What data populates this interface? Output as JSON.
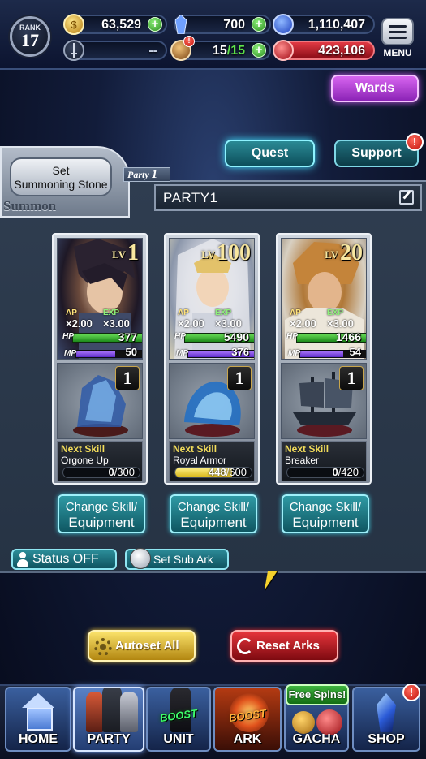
{
  "hud": {
    "rank_label": "RANK",
    "rank_value": "17",
    "gold": "63,529",
    "gems": "700",
    "orbs": "1,110,407",
    "sword_value": "--",
    "stamina": "15",
    "stamina_max": "/15",
    "red_points": "423,106",
    "menu_label": "MENU",
    "alert_glyph": "!"
  },
  "top_buttons": {
    "wards": "Wards",
    "quest": "Quest",
    "support": "Support",
    "support_alert": "!"
  },
  "summon": {
    "set_stone_line1": "Set",
    "set_stone_line2": "Summoning Stone",
    "summon_label": "Summon",
    "party_tag_text": "Party",
    "party_tag_number": "1",
    "party_name": "PARTY1"
  },
  "units": [
    {
      "lv_prefix": "LV",
      "level": "1",
      "ap_label": "AP",
      "ap_mult": "×2.00",
      "exp_label": "EXP",
      "exp_mult": "×3.00",
      "hp_label": "HP",
      "hp": "377",
      "mp_label": "MP",
      "mp": "50",
      "mp_fill": 0.55,
      "ark_level": "1",
      "next_skill_label": "Next Skill",
      "skill_name": "Orgone Up",
      "skill_progress": "0",
      "skill_total": "/300",
      "skill_fraction": 0.0,
      "change_l1": "Change Skill/",
      "change_l2": "Equipment"
    },
    {
      "lv_prefix": "LV",
      "level": "100",
      "ap_label": "AP",
      "ap_mult": "×2.00",
      "exp_label": "EXP",
      "exp_mult": "×3.00",
      "hp_label": "HP",
      "hp": "5490",
      "mp_label": "MP",
      "mp": "376",
      "mp_fill": 0.95,
      "ark_level": "1",
      "next_skill_label": "Next Skill",
      "skill_name": "Royal Armor",
      "skill_progress": "448",
      "skill_total": "/600",
      "skill_fraction": 0.747,
      "change_l1": "Change Skill/",
      "change_l2": "Equipment"
    },
    {
      "lv_prefix": "LV",
      "level": "20",
      "ap_label": "AP",
      "ap_mult": "×2.00",
      "exp_label": "EXP",
      "exp_mult": "×3.00",
      "hp_label": "HP",
      "hp": "1466",
      "mp_label": "MP",
      "mp": "54",
      "mp_fill": 0.6,
      "ark_level": "1",
      "next_skill_label": "Next Skill",
      "skill_name": "Breaker",
      "skill_progress": "0",
      "skill_total": "/420",
      "skill_fraction": 0.0,
      "change_l1": "Change Skill/",
      "change_l2": "Equipment"
    }
  ],
  "controls": {
    "status_toggle": "Status OFF",
    "set_sub_ark": "Set Sub Ark",
    "autoset_all": "Autoset All",
    "reset_arks": "Reset Arks"
  },
  "nav": {
    "home": "HOME",
    "party": "PARTY",
    "unit": "UNIT",
    "ark": "ARK",
    "gacha": "GACHA",
    "shop": "SHOP",
    "boost": "BOOST",
    "free_spins": "Free Spins!",
    "shop_alert": "!"
  },
  "icons": {
    "gold": "gold-coin-icon",
    "gem": "crystal-icon",
    "orb": "blue-orb-icon",
    "sword": "sword-icon",
    "stamina": "stamina-icon",
    "red": "red-orb-icon"
  },
  "colors": {
    "accent_teal": "#2f9aa5",
    "wards_purple": "#d865f0",
    "autoset_gold": "#fbe36b",
    "reset_red": "#e6343b",
    "green_plus": "#3fbf2a",
    "red_points_bar": "#c4182a"
  }
}
